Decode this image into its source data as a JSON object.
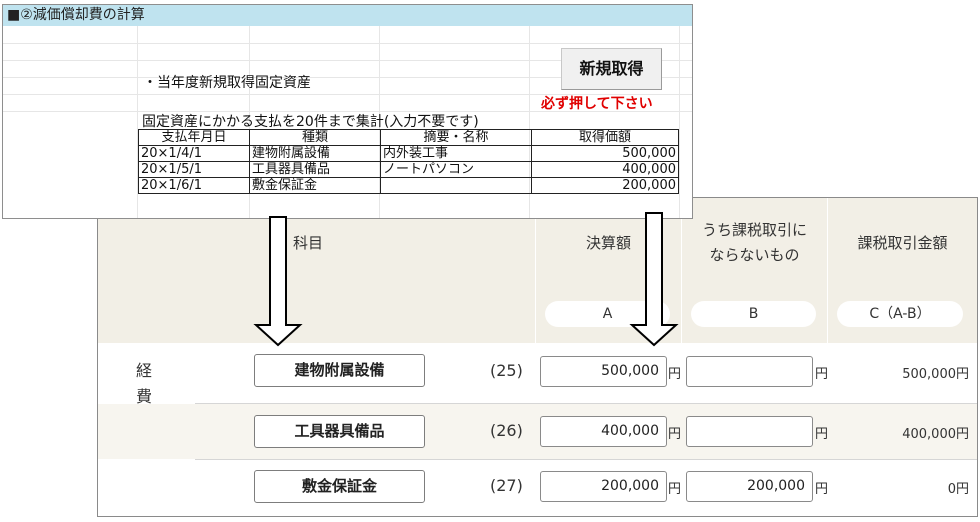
{
  "sheet": {
    "title": "■②減価償却費の計算",
    "new_assets_label": "・当年度新規取得固定資産",
    "new_button": "新規取得",
    "must_press": "必ず押して下さい",
    "note": "固定資産にかかる支払を20件まで集計(入力不要です)",
    "headers": [
      "支払年月日",
      "種類",
      "摘要・名称",
      "取得価額"
    ],
    "rows": [
      {
        "date": "20×1/4/1",
        "kind": "建物附属設備",
        "desc": "内外装工事",
        "amount": "500,000"
      },
      {
        "date": "20×1/5/1",
        "kind": "工具器具備品",
        "desc": "ノートパソコン",
        "amount": "400,000"
      },
      {
        "date": "20×1/6/1",
        "kind": "敷金保証金",
        "desc": "",
        "amount": "200,000"
      }
    ]
  },
  "form": {
    "col_subject": "科目",
    "col_settlement": "決算額",
    "col_nontaxable": "うち課税取引に\nならないもの",
    "col_taxable": "課税取引金額",
    "pill_a": "A",
    "pill_b": "B",
    "pill_c": "C（A-B）",
    "side_label": "経\n費",
    "yen": "円",
    "rows": [
      {
        "item": "建物附属設備",
        "num": "(25)",
        "a": "500,000",
        "b": "",
        "c": "500,000円"
      },
      {
        "item": "工具器具備品",
        "num": "(26)",
        "a": "400,000",
        "b": "",
        "c": "400,000円"
      },
      {
        "item": "敷金保証金",
        "num": "(27)",
        "a": "200,000",
        "b": "200,000",
        "c": "0円"
      }
    ]
  },
  "colors": {
    "title_bar": "#bfe3ef",
    "header_bg": "#f2efe6",
    "warning": "#e00000",
    "arrow_fill": "#ffffff",
    "arrow_stroke": "#000000"
  },
  "arrows": [
    {
      "from": "sheet.rows.kind",
      "to": "form.rows.item"
    },
    {
      "from": "sheet.rows.amount",
      "to": "form.rows.a"
    }
  ]
}
